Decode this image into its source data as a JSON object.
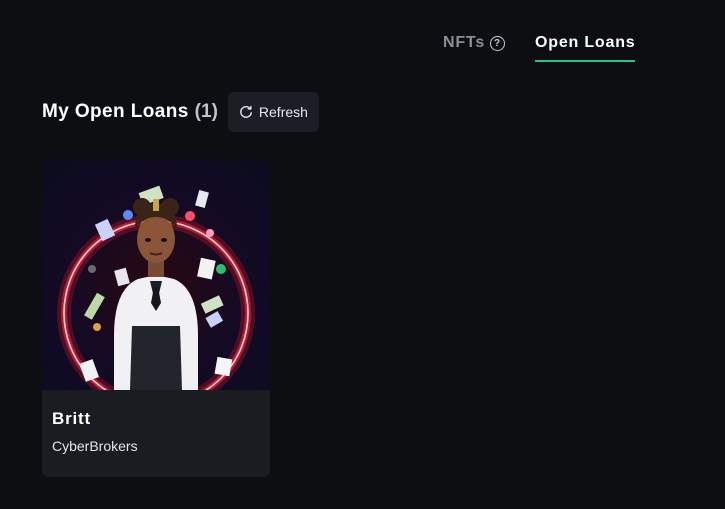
{
  "tabs": [
    {
      "label": "NFTs",
      "active": false
    },
    {
      "label": "Open Loans",
      "active": true
    }
  ],
  "section": {
    "title": "My Open Loans",
    "count": "(1)",
    "refresh_label": "Refresh"
  },
  "loans": [
    {
      "name": "Britt",
      "collection": "CyberBrokers",
      "image_icon": "cyberbroker-avatar"
    }
  ],
  "colors": {
    "background": "#0d0e12",
    "card": "#1b1c22",
    "accent": "#1fc58b",
    "button": "#1c1e25",
    "muted_tab": "#8a8f9c",
    "ring": "#ff1a2e"
  }
}
